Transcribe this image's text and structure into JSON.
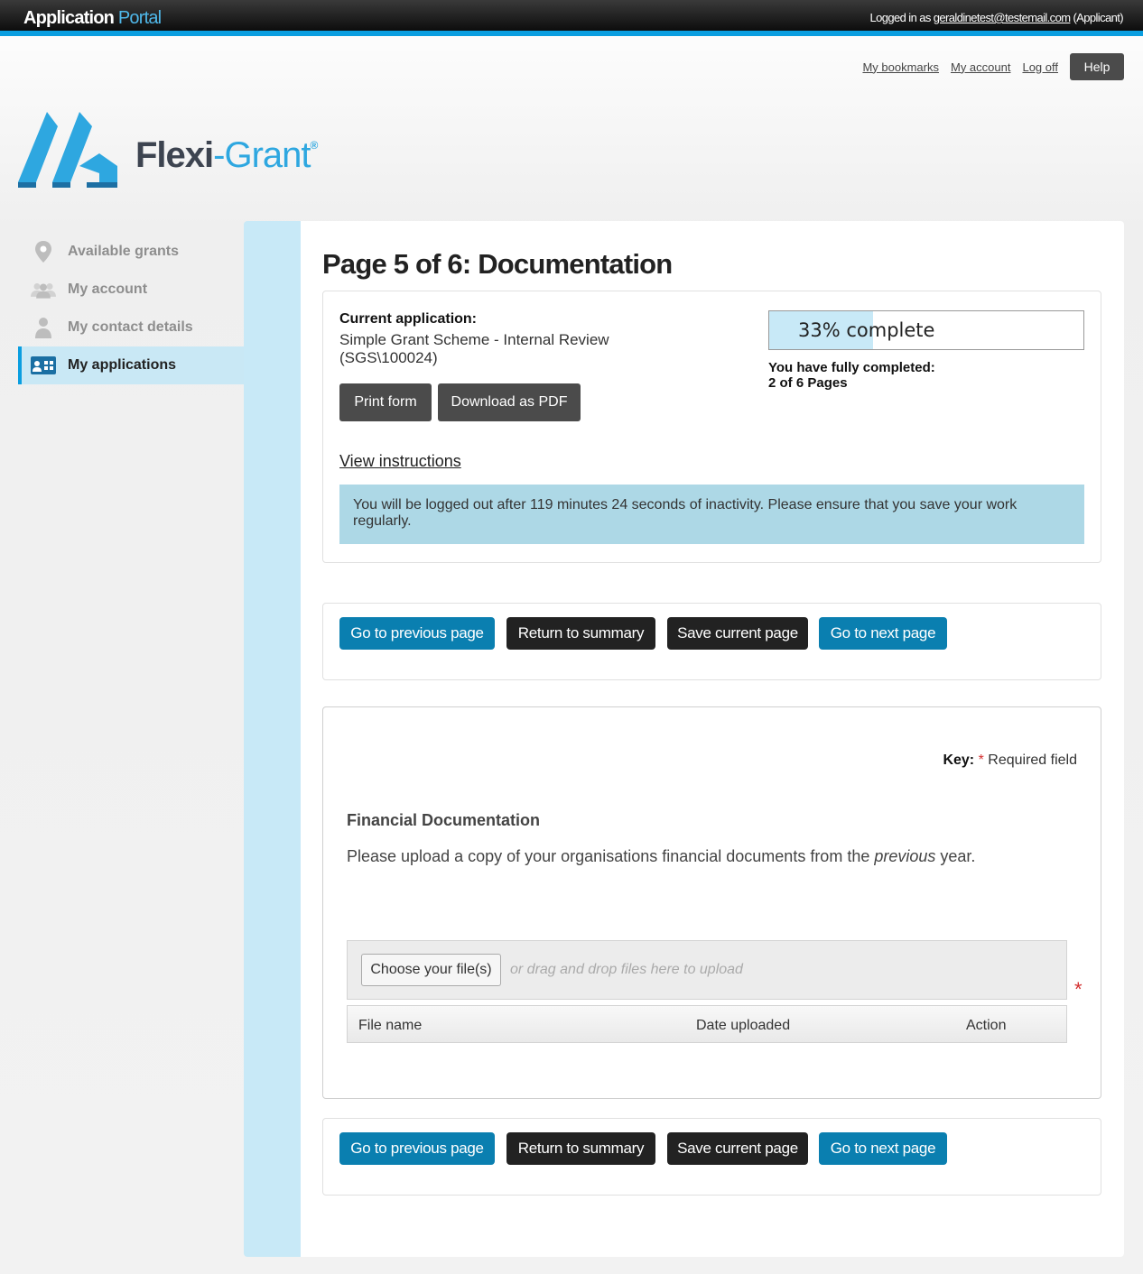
{
  "topbar": {
    "portal_bold": "Application",
    "portal_light": "Portal",
    "logged_in_prefix": "Logged in as",
    "user_email": "geraldinetest@testemail.com",
    "user_role": "(Applicant)"
  },
  "toplinks": {
    "bookmarks": "My bookmarks",
    "account": "My account",
    "logoff": "Log off",
    "help": "Help"
  },
  "logo": {
    "flexi": "Flexi",
    "grant": "-Grant",
    "reg": "®"
  },
  "sidebar": {
    "items": [
      {
        "label": "Available grants",
        "icon": "map-pin-icon"
      },
      {
        "label": "My account",
        "icon": "users-icon"
      },
      {
        "label": "My contact details",
        "icon": "person-icon"
      },
      {
        "label": "My applications",
        "icon": "id-card-icon"
      }
    ],
    "active_index": 3
  },
  "page": {
    "title": "Page 5 of 6: Documentation"
  },
  "application": {
    "label": "Current application:",
    "name": "Simple Grant Scheme - Internal Review",
    "ref": "(SGS\\100024)",
    "print_label": "Print form",
    "pdf_label": "Download as PDF",
    "instructions_label": "View instructions",
    "timeout_message": "You will be logged out after 119 minutes 24 seconds of inactivity. Please ensure that you save your work regularly.",
    "progress_percent": 33,
    "progress_text": "33% complete",
    "completed_line1": "You have fully completed:",
    "completed_line2": "2 of 6 Pages"
  },
  "nav_buttons": {
    "previous": "Go to previous page",
    "summary": "Return to summary",
    "save": "Save current page",
    "next": "Go to next page"
  },
  "form": {
    "key_label": "Key:",
    "required_star": "*",
    "required_text": "Required field",
    "section_heading": "Financial Documentation",
    "desc_before": "Please upload a copy of your organisations financial documents from the ",
    "desc_italic": "previous",
    "desc_after": " year.",
    "choose_label": "Choose your file(s)",
    "drag_text": "or drag and drop files here to upload",
    "table_headers": [
      "File name",
      "Date uploaded",
      "Action"
    ]
  },
  "colors": {
    "accent": "#0a9ee0",
    "nav_blue": "#0a7fb0",
    "dark_button": "#222222",
    "grey_button": "#4b4b4b",
    "timeout_bg": "#add8e6",
    "sidebar_active_bg": "#c9e8f5"
  }
}
